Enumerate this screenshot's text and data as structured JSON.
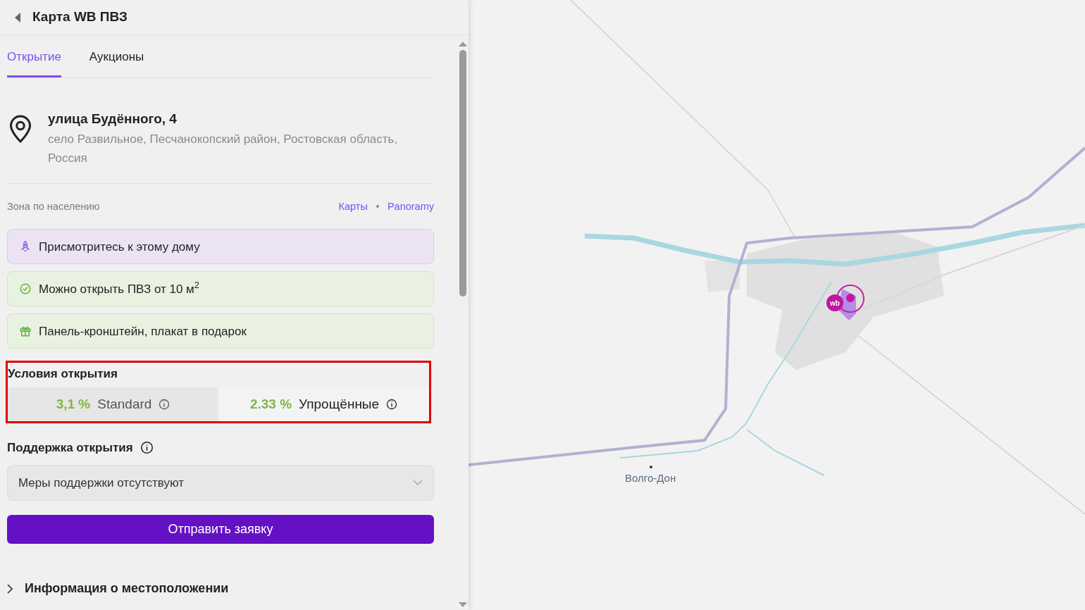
{
  "header": {
    "title": "Карта WB ПВЗ"
  },
  "tabs": [
    {
      "label": "Открытие",
      "selected": true
    },
    {
      "label": "Аукционы",
      "selected": false
    }
  ],
  "address": {
    "street": "улица Будённого, 4",
    "locality": "село Развильное, Песчанокопский район, Ростовская область, Россия"
  },
  "zone": {
    "label": "Зона по населению",
    "links": [
      "Карты",
      "Panoramy"
    ]
  },
  "notices": [
    {
      "kind": "rocket",
      "text": "Присмотритесь к этому дому"
    },
    {
      "kind": "check",
      "text": "Можно открыть ПВЗ от 10 м$^{2}$"
    },
    {
      "kind": "gift",
      "text": "Панель-кронштейн, плакат в подарок"
    }
  ],
  "conditions": {
    "title": "Условия открытия",
    "highlighted": true,
    "options": [
      {
        "rate": "3,1 %",
        "name": "Standard",
        "selected": false
      },
      {
        "rate": "2.33 %",
        "name": "Упрощённые",
        "selected": true
      }
    ]
  },
  "support": {
    "title": "Поддержка открытия",
    "value": "Меры поддержки отсутствуют"
  },
  "submit": "Отправить заявку",
  "location_info": {
    "title": "Информация о местоположении",
    "expanded": false
  },
  "map": {
    "marker_label": "wb",
    "place_label": "Волго-Дон"
  }
}
